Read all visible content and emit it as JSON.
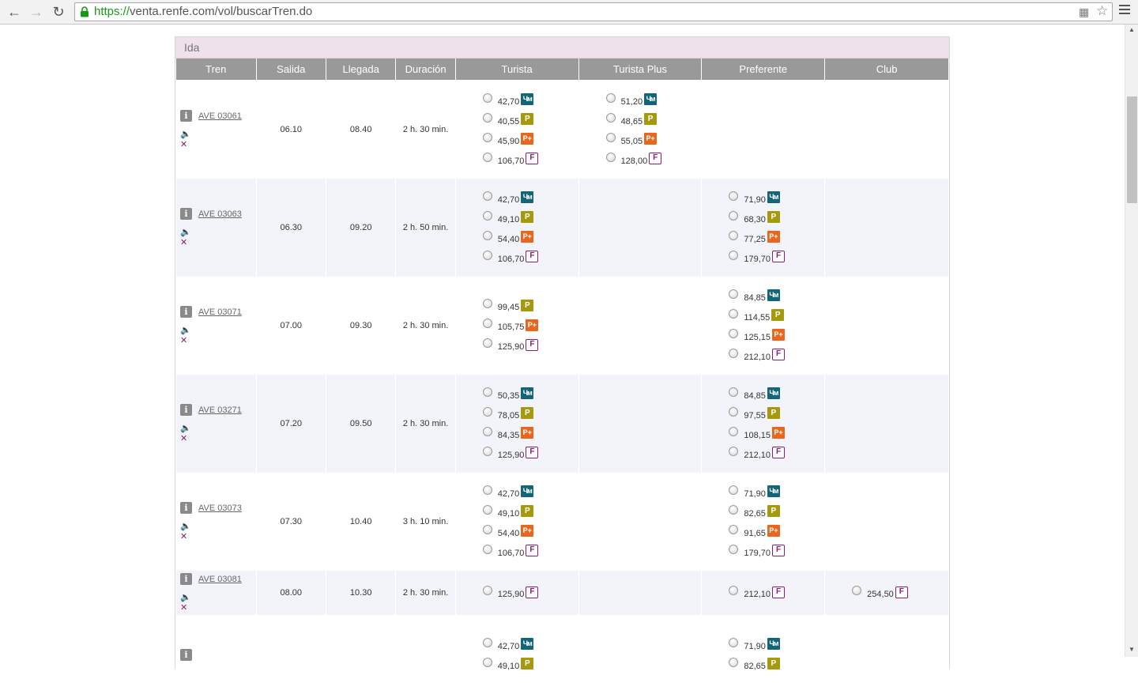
{
  "browser": {
    "url_protocol": "https://",
    "url_rest": "venta.renfe.com/vol/buscarTren.do"
  },
  "section": {
    "title": "Ida"
  },
  "columns": [
    "Tren",
    "Salida",
    "Llegada",
    "Duración",
    "Turista",
    "Turista Plus",
    "Preferente",
    "Club"
  ],
  "trains": [
    {
      "name": "AVE 03061",
      "salida": "06.10",
      "llegada": "08.40",
      "duracion": "2 h. 30 min.",
      "turista": [
        [
          "42,70",
          "promo"
        ],
        [
          "40,55",
          "p"
        ],
        [
          "45,90",
          "pplus"
        ],
        [
          "106,70",
          "f"
        ]
      ],
      "turista_plus": [
        [
          "51,20",
          "promo"
        ],
        [
          "48,65",
          "p"
        ],
        [
          "55,05",
          "pplus"
        ],
        [
          "128,00",
          "f"
        ]
      ],
      "preferente": [],
      "club": []
    },
    {
      "name": "AVE 03063",
      "salida": "06.30",
      "llegada": "09.20",
      "duracion": "2 h. 50 min.",
      "turista": [
        [
          "42,70",
          "promo"
        ],
        [
          "49,10",
          "p"
        ],
        [
          "54,40",
          "pplus"
        ],
        [
          "106,70",
          "f"
        ]
      ],
      "turista_plus": [],
      "preferente": [
        [
          "71,90",
          "promo"
        ],
        [
          "68,30",
          "p"
        ],
        [
          "77,25",
          "pplus"
        ],
        [
          "179,70",
          "f"
        ]
      ],
      "club": []
    },
    {
      "name": "AVE 03071",
      "salida": "07.00",
      "llegada": "09.30",
      "duracion": "2 h. 30 min.",
      "turista": [
        [
          "99,45",
          "p"
        ],
        [
          "105,75",
          "pplus"
        ],
        [
          "125,90",
          "f"
        ]
      ],
      "turista_plus": [],
      "preferente": [
        [
          "84,85",
          "promo"
        ],
        [
          "114,55",
          "p"
        ],
        [
          "125,15",
          "pplus"
        ],
        [
          "212,10",
          "f"
        ]
      ],
      "club": []
    },
    {
      "name": "AVE 03271",
      "salida": "07.20",
      "llegada": "09.50",
      "duracion": "2 h. 30 min.",
      "turista": [
        [
          "50,35",
          "promo"
        ],
        [
          "78,05",
          "p"
        ],
        [
          "84,35",
          "pplus"
        ],
        [
          "125,90",
          "f"
        ]
      ],
      "turista_plus": [],
      "preferente": [
        [
          "84,85",
          "promo"
        ],
        [
          "97,55",
          "p"
        ],
        [
          "108,15",
          "pplus"
        ],
        [
          "212,10",
          "f"
        ]
      ],
      "club": []
    },
    {
      "name": "AVE 03073",
      "salida": "07.30",
      "llegada": "10.40",
      "duracion": "3 h. 10 min.",
      "turista": [
        [
          "42,70",
          "promo"
        ],
        [
          "49,10",
          "p"
        ],
        [
          "54,40",
          "pplus"
        ],
        [
          "106,70",
          "f"
        ]
      ],
      "turista_plus": [],
      "preferente": [
        [
          "71,90",
          "promo"
        ],
        [
          "82,65",
          "p"
        ],
        [
          "91,65",
          "pplus"
        ],
        [
          "179,70",
          "f"
        ]
      ],
      "club": []
    },
    {
      "name": "AVE 03081",
      "salida": "08.00",
      "llegada": "10.30",
      "duracion": "2 h. 30 min.",
      "turista": [
        [
          "125,90",
          "f"
        ]
      ],
      "turista_plus": [],
      "preferente": [
        [
          "212,10",
          "f"
        ]
      ],
      "club": [
        [
          "254,50",
          "f"
        ]
      ]
    },
    {
      "name": "",
      "salida": "",
      "llegada": "",
      "duracion": "",
      "turista": [
        [
          "42,70",
          "promo"
        ],
        [
          "49,10",
          "p"
        ]
      ],
      "turista_plus": [],
      "preferente": [
        [
          "71,90",
          "promo"
        ],
        [
          "82,65",
          "p"
        ]
      ],
      "club": []
    }
  ],
  "badges": {
    "promo": "Чм",
    "p": "P",
    "pplus": "P+",
    "f": "F"
  },
  "colors": {
    "promo": "#136579",
    "p": "#a59a0e",
    "pplus": "#e8671c",
    "f": "#8b1b76",
    "header": "#999999",
    "section": "#efe1ec"
  },
  "icons": [
    "back-icon",
    "forward-icon",
    "reload-icon",
    "lock-icon",
    "translate-icon",
    "star-icon",
    "menu-icon",
    "info-icon",
    "mute-icon"
  ]
}
